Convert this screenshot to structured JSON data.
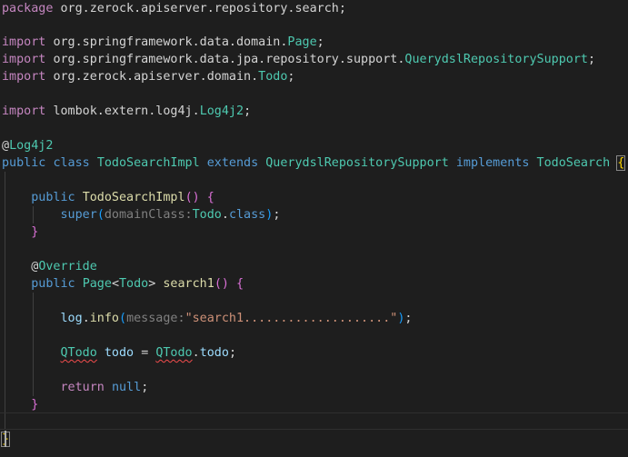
{
  "editor": {
    "language": "java",
    "theme_colors": {
      "background": "#1e1e1e",
      "keyword": "#569cd6",
      "type": "#4ec9b0",
      "function": "#dcdcaa",
      "string": "#ce9178",
      "error_squiggle": "#f14c4c"
    },
    "code": {
      "package_kw": "package",
      "package_name": "org.zerock.apiserver.repository.search",
      "semi": ";",
      "import_kw": "import",
      "import1": "org.springframework.data.domain.",
      "import1_type": "Page",
      "import2": "org.springframework.data.jpa.repository.support.",
      "import2_type": "QuerydslRepositorySupport",
      "import3": "org.zerock.apiserver.domain.",
      "import3_type": "Todo",
      "import4": "lombok.extern.log4j.",
      "import4_type": "Log4j2",
      "at": "@",
      "log4j2": "Log4j2",
      "public_kw": "public",
      "class_kw": "class",
      "class_name": "TodoSearchImpl",
      "extends_kw": "extends",
      "super_class": "QuerydslRepositorySupport",
      "implements_kw": "implements",
      "interface_name": "TodoSearch",
      "open_brace": "{",
      "close_brace": "}",
      "ctor_name": "TodoSearchImpl",
      "empty_parens": "()",
      "super_kw": "super",
      "open_paren": "(",
      "close_paren": ")",
      "hint_domain": "domainClass:",
      "todo": "Todo",
      "dot": ".",
      "class_lit": "class",
      "override": "Override",
      "page": "Page",
      "lt": "<",
      "gt": ">",
      "search1": "search1",
      "log": "log",
      "info": "info",
      "hint_message": "message:",
      "message_str": "\"search1....................\"",
      "qtodo": "QTodo",
      "todo_var": "todo",
      "eq": "=",
      "return_kw": "return",
      "null_kw": "null"
    }
  }
}
